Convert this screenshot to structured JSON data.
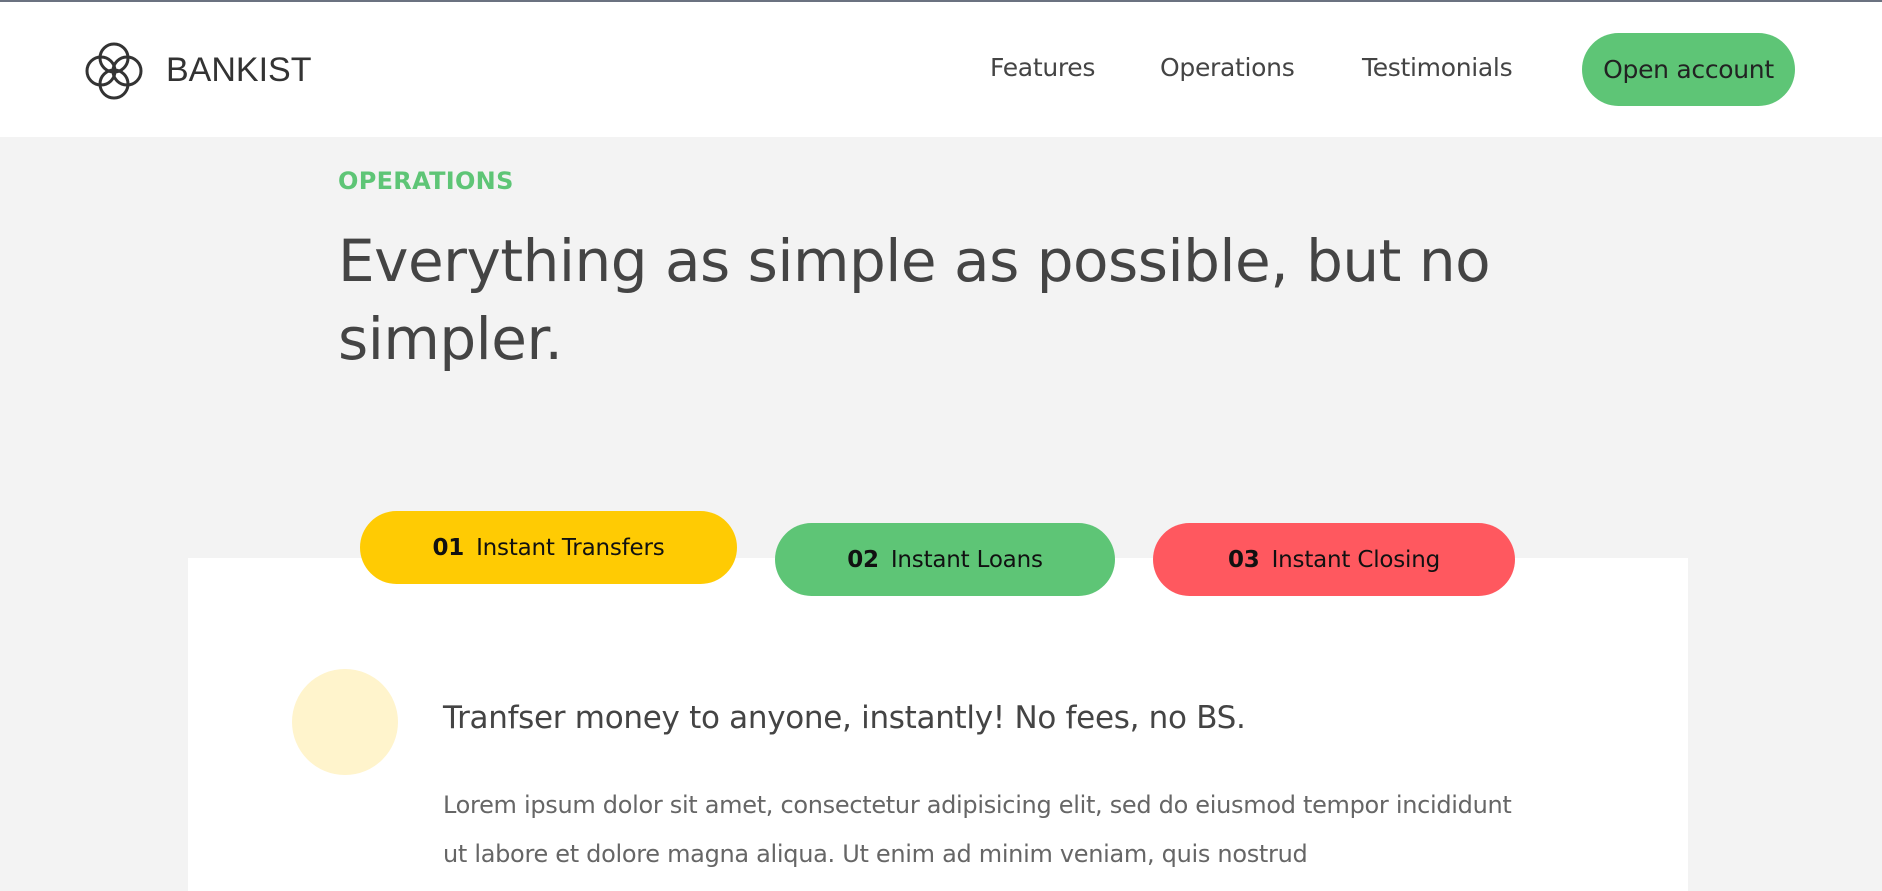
{
  "brand": {
    "name": "BANKIST",
    "logo_icon": "bankist-rings-logo-icon"
  },
  "nav": {
    "links": [
      "Features",
      "Operations",
      "Testimonials"
    ],
    "cta": "Open account"
  },
  "section": {
    "eyebrow": "OPERATIONS",
    "headline": "Everything as simple as possible, but no simpler."
  },
  "tabs": [
    {
      "num": "01",
      "label": "Instant Transfers",
      "color": "#ffcb03",
      "active": true
    },
    {
      "num": "02",
      "label": "Instant Loans",
      "color": "#5ec576",
      "active": false
    },
    {
      "num": "03",
      "label": "Instant Closing",
      "color": "#ff585f",
      "active": false
    }
  ],
  "content": {
    "icon_bg": "#fff4cc",
    "title": "Tranfser money to anyone, instantly! No fees, no BS.",
    "text": "Lorem ipsum dolor sit amet, consectetur adipisicing elit, sed do eiusmod tempor incididunt ut labore et dolore magna aliqua. Ut enim ad minim veniam, quis nostrud"
  },
  "colors": {
    "accent": "#5ec576",
    "text": "#444444",
    "background": "#f3f3f3"
  }
}
